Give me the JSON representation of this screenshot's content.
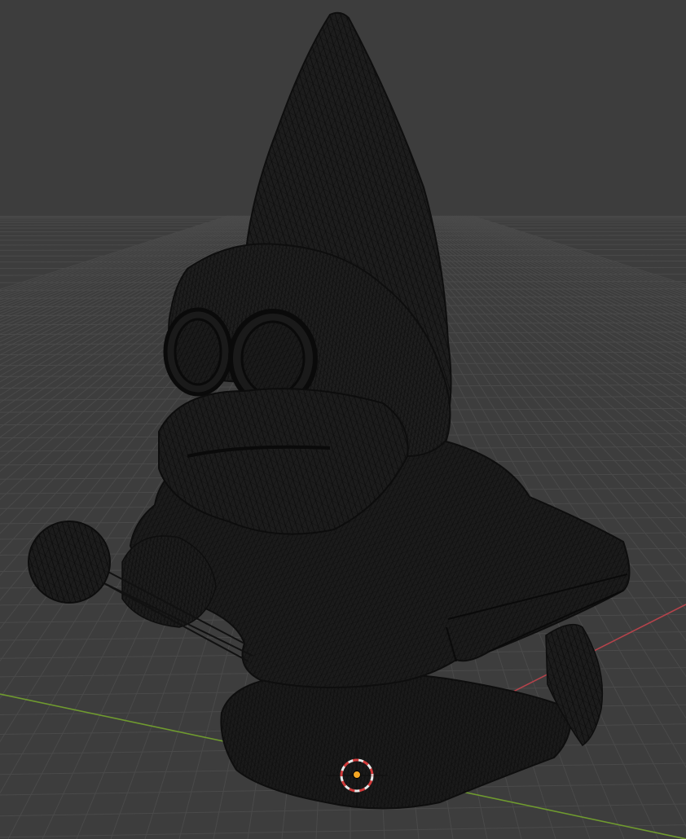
{
  "viewport": {
    "view_name": "3d-viewport",
    "shading_mode": "wireframe",
    "object": "gnome-mesh",
    "background_color": "#3d3d3d",
    "grid_color": "#4a4a4a",
    "wire_color": "#0f0f0f",
    "mesh_fill_color": "#1c1c1c",
    "x_axis_color": "#b5434b",
    "y_axis_color": "#6f9a2f",
    "cursor_color": "#d23b3b",
    "origin_color": "#f5a623"
  }
}
